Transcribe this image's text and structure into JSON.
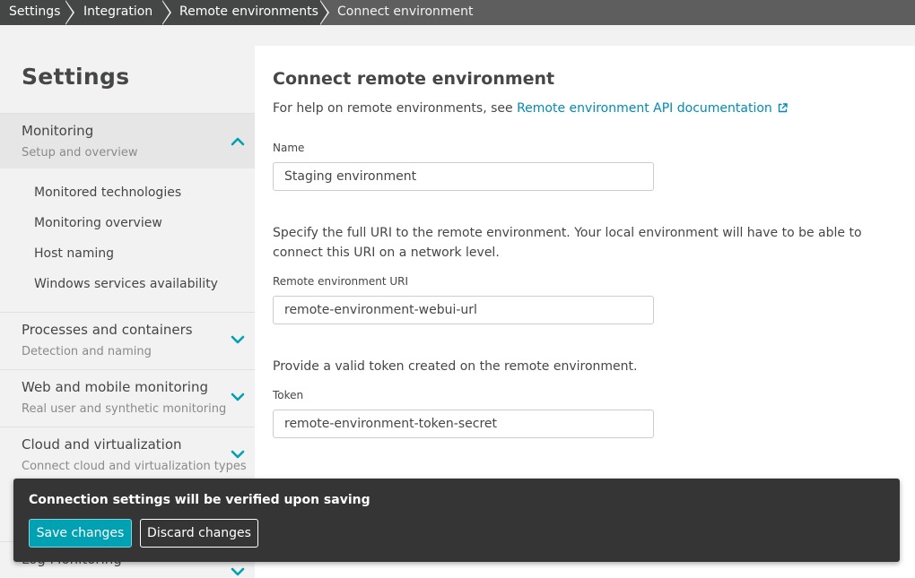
{
  "breadcrumb": {
    "items": [
      "Settings",
      "Integration",
      "Remote environments"
    ],
    "current": "Connect environment"
  },
  "sidebar": {
    "title": "Settings",
    "groups": [
      {
        "title": "Monitoring",
        "subtitle": "Setup and overview",
        "expanded": true,
        "items": [
          "Monitored technologies",
          "Monitoring overview",
          "Host naming",
          "Windows services availability"
        ]
      },
      {
        "title": "Processes and containers",
        "subtitle": "Detection and naming",
        "expanded": false
      },
      {
        "title": "Web and mobile monitoring",
        "subtitle": "Real user and synthetic monitoring",
        "expanded": false
      },
      {
        "title": "Cloud and virtualization",
        "subtitle": "Connect cloud and virtualization types",
        "expanded": false
      },
      {
        "title": "Log Monitoring",
        "subtitle": "",
        "expanded": false
      }
    ]
  },
  "main": {
    "title": "Connect remote environment",
    "help_prefix": "For help on remote environments, see ",
    "help_link": "Remote environment API documentation",
    "name_label": "Name",
    "name_value": "Staging environment",
    "uri_description": "Specify the full URI to the remote environment. Your local environment will have to be able to connect this URI on a network level.",
    "uri_label": "Remote environment URI",
    "uri_value": "remote-environment-webui-url",
    "token_description": "Provide a valid token created on the remote environment.",
    "token_label": "Token",
    "token_value": "remote-environment-token-secret"
  },
  "toast": {
    "message": "Connection settings will be verified upon saving",
    "save_label": "Save changes",
    "discard_label": "Discard changes"
  },
  "colors": {
    "accent": "#008cb4",
    "chevron": "#00a1b2",
    "toast_bg": "#353535",
    "primary_button": "#00a1b2",
    "breadcrumb_bg": "#454646"
  },
  "icons": {
    "external_link": "external-link-icon",
    "chevron_up": "chevron-up-icon",
    "chevron_down": "chevron-down-icon"
  }
}
